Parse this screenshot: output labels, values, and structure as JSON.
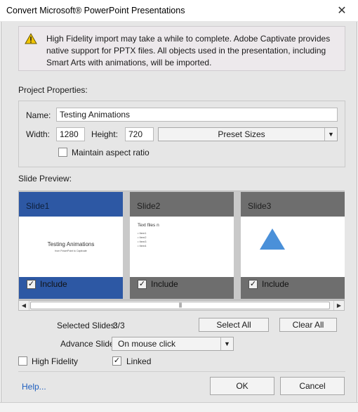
{
  "window": {
    "title": "Convert Microsoft® PowerPoint Presentations",
    "close_glyph": "✕"
  },
  "warning": {
    "icon": "warning-icon",
    "text": "High Fidelity import may take a while to complete. Adobe Captivate provides native support for PPTX files. All objects used in the presentation, including Smart Arts with animations, will be imported."
  },
  "project": {
    "section_label": "Project Properties:",
    "name_label": "Name:",
    "name_value": "Testing Animations",
    "width_label": "Width:",
    "width_value": "1280",
    "height_label": "Height:",
    "height_value": "720",
    "preset_label": "Preset Sizes",
    "aspect_label": "Maintain aspect ratio",
    "aspect_checked": false
  },
  "preview": {
    "section_label": "Slide Preview:",
    "include_label": "Include",
    "slides": [
      {
        "label": "Slide1",
        "selected": true,
        "included": true,
        "thumb_title": "Testing Animations",
        "thumb_sub": "from PowerPoint to Captivate"
      },
      {
        "label": "Slide2",
        "selected": false,
        "included": true,
        "thumb_title": "Text files n",
        "thumb_items": [
          "Item1",
          "Item2",
          "Item3",
          "Item4"
        ]
      },
      {
        "label": "Slide3",
        "selected": false,
        "included": true,
        "accent": "#4a90d9"
      }
    ]
  },
  "selection": {
    "selected_label": "Selected Slides:",
    "selected_value": "3/3",
    "select_all": "Select All",
    "clear_all": "Clear All",
    "advance_label": "Advance Slide:",
    "advance_value": "On mouse click"
  },
  "options": {
    "high_fidelity_label": "High Fidelity",
    "high_fidelity_checked": false,
    "linked_label": "Linked",
    "linked_checked": true
  },
  "footer": {
    "help": "Help...",
    "ok": "OK",
    "cancel": "Cancel"
  },
  "colors": {
    "selected_slide": "#2d58a4",
    "unselected_slide": "#6e6e6e",
    "dialog_bg": "#e6e6e6"
  }
}
